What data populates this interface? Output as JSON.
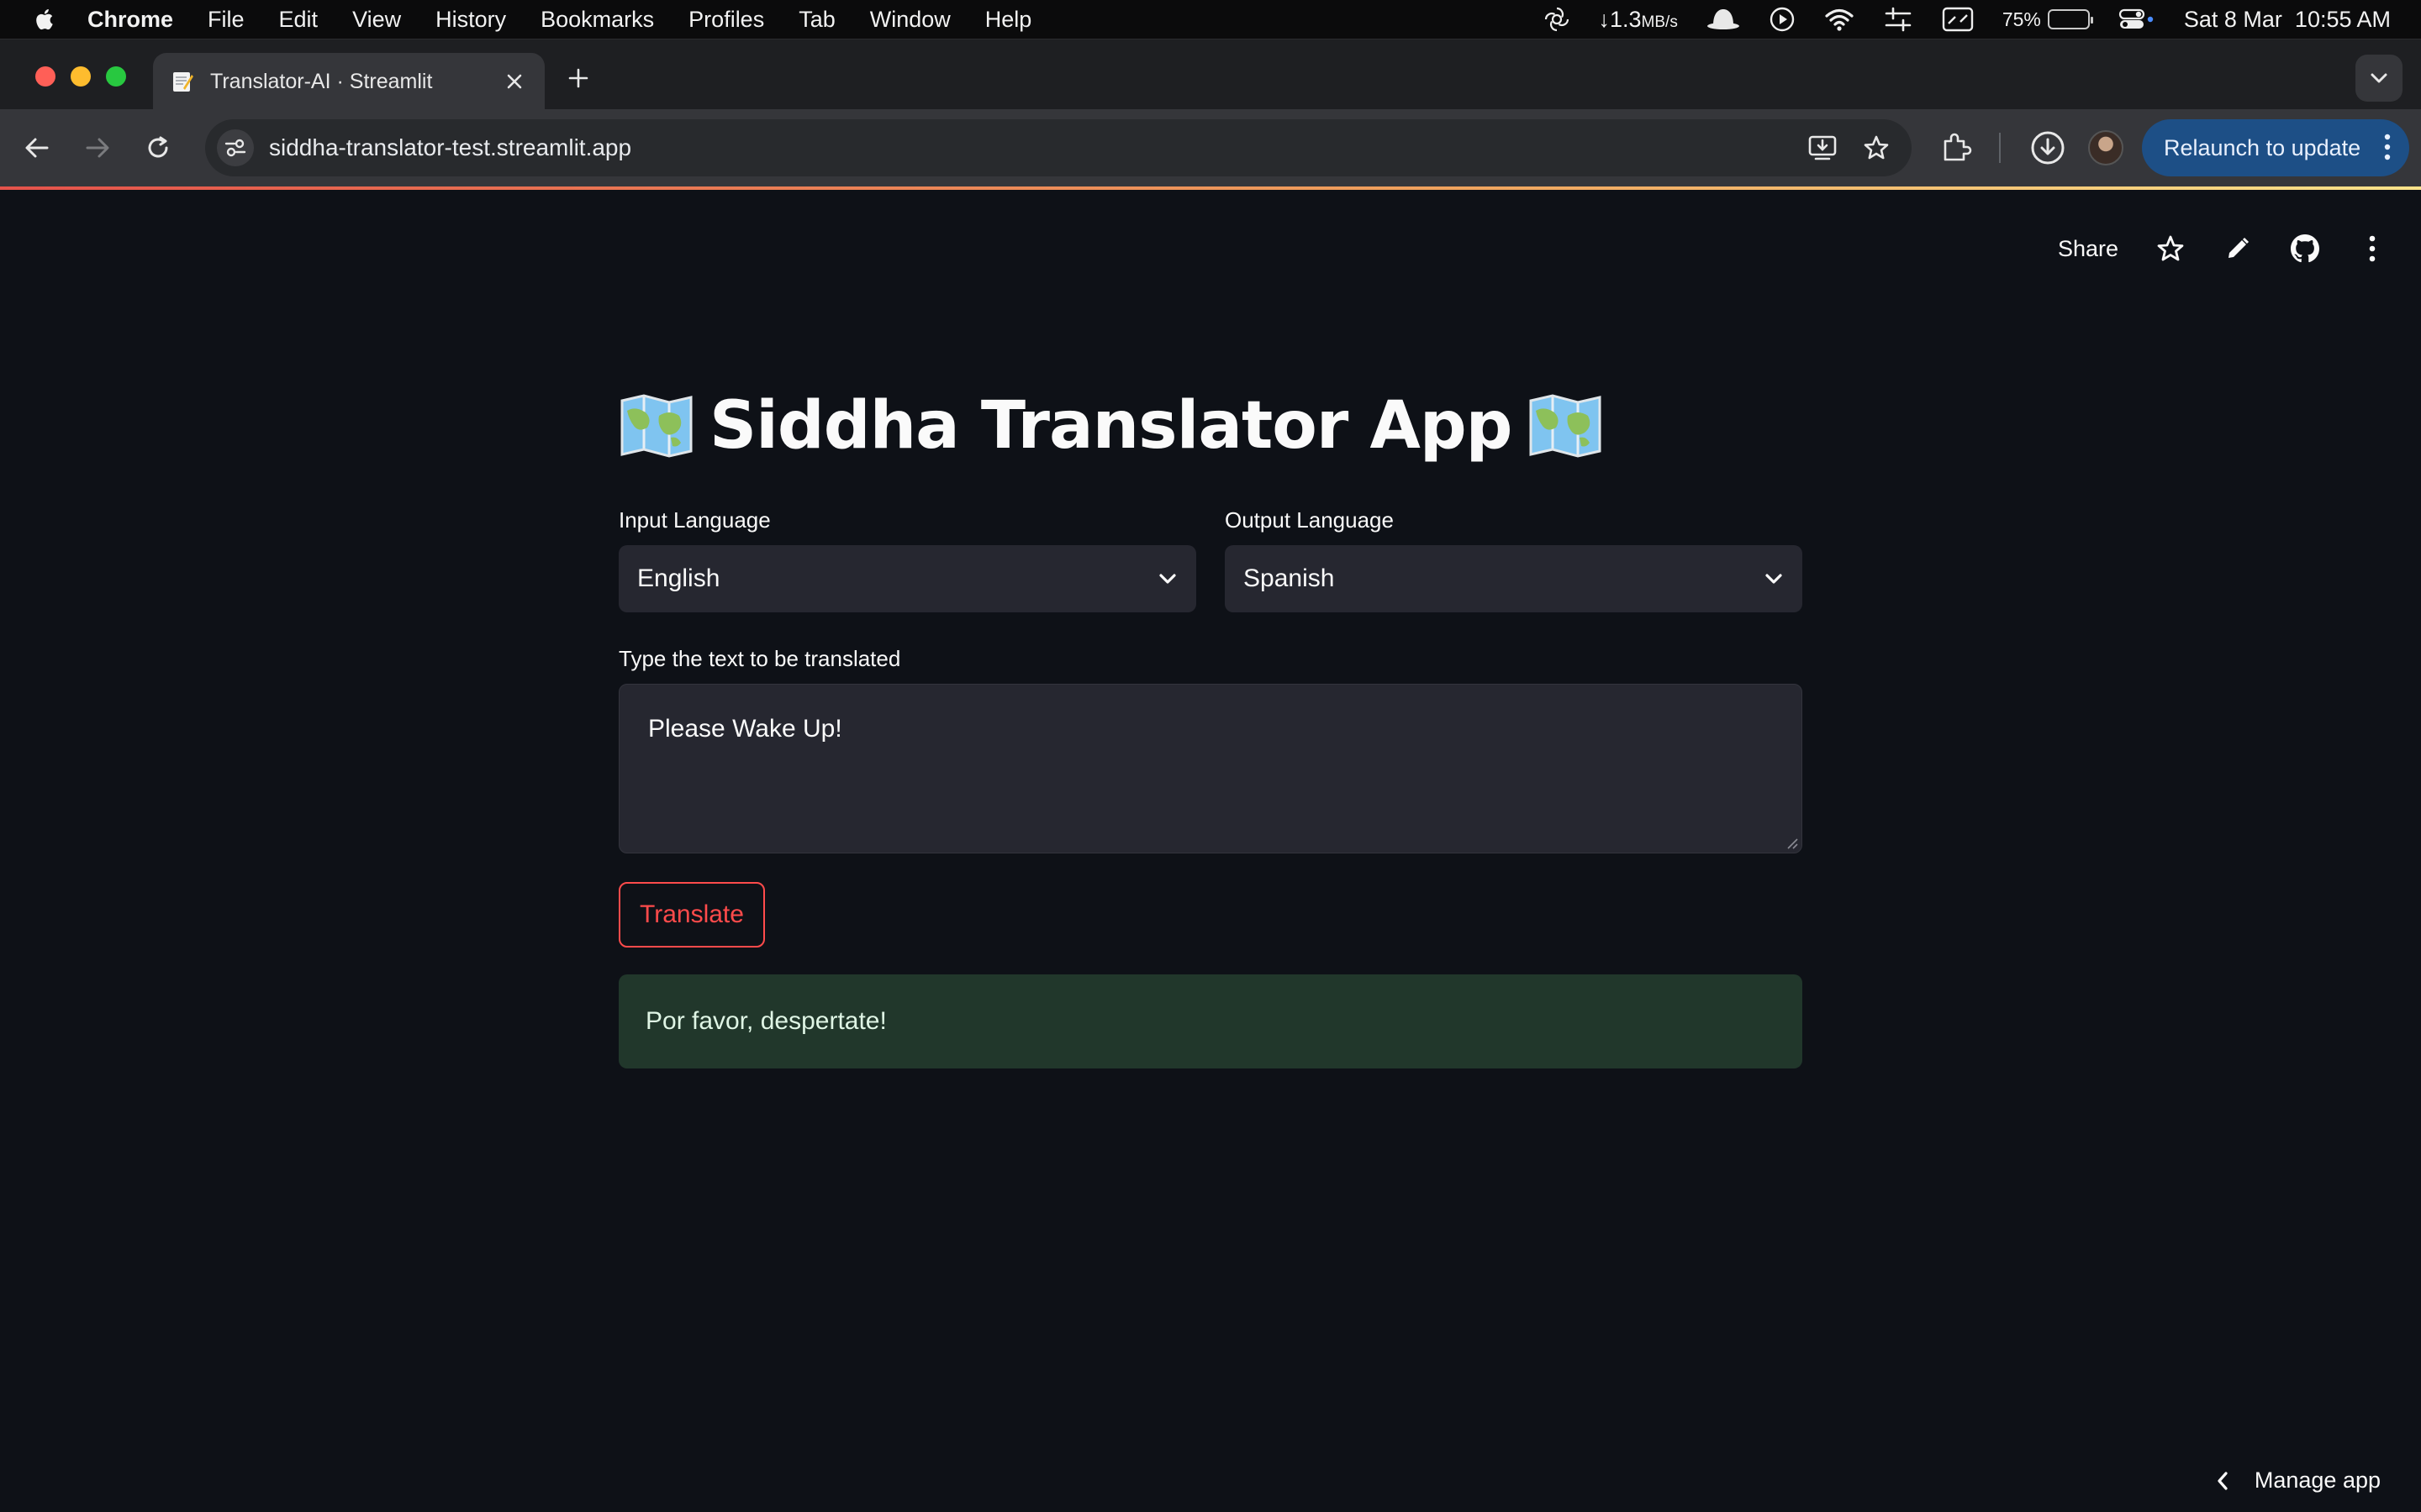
{
  "menubar": {
    "app_name": "Chrome",
    "items": [
      "File",
      "Edit",
      "View",
      "History",
      "Bookmarks",
      "Profiles",
      "Tab",
      "Window",
      "Help"
    ],
    "network_speed": "↓1.3",
    "network_unit": "MB/s",
    "battery_percent": "75%",
    "battery_level": 0.75,
    "datetime": "Sat 8 Mar  10:55 AM"
  },
  "browser": {
    "tab_title": "Translator-AI · Streamlit",
    "url": "siddha-translator-test.streamlit.app",
    "relaunch_label": "Relaunch to update"
  },
  "streamlit_header": {
    "share_label": "Share"
  },
  "app": {
    "title": "Siddha Translator App",
    "input_language_label": "Input Language",
    "input_language_value": "English",
    "output_language_label": "Output Language",
    "output_language_value": "Spanish",
    "text_label": "Type the text to be translated",
    "text_value": "Please Wake Up!",
    "translate_button": "Translate",
    "result_text": "Por favor, despertate!"
  },
  "footer": {
    "manage_app_label": "Manage app"
  },
  "colors": {
    "page_bg": "#0e1117",
    "widget_bg": "#262730",
    "primary": "#ff4b4b",
    "success_bg": "#21372b"
  }
}
